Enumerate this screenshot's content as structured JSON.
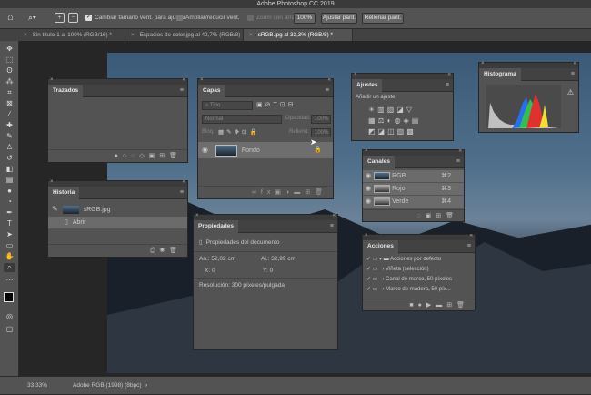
{
  "app": {
    "title": "Adobe Photoshop CC 2019"
  },
  "options": {
    "resize_windows_label": "Cambiar tamaño vent. para ajustar",
    "zoom_all_label": "Ampliar/reducir vent.",
    "scrubby_label": "Zoom con arrastre",
    "zoom_value": "100%",
    "fit_screen_label": "Ajustar pant.",
    "fill_screen_label": "Rellenar pant."
  },
  "tabs": [
    {
      "label": "Sin título-1 al 100% (RGB/16) *"
    },
    {
      "label": "Espacios de color.jpg al 42,7% (RGB/8)"
    },
    {
      "label": "sRGB.jpg al 33,3% (RGB/8) *"
    }
  ],
  "panels": {
    "trazados": {
      "title": "Trazados"
    },
    "historia": {
      "title": "Historia",
      "snapshot": "sRGB.jpg",
      "items": [
        "Abrir"
      ]
    },
    "capas": {
      "title": "Capas",
      "filter": "Tipo",
      "blend": "Normal",
      "opacity_label": "Opacidad:",
      "opacity_value": "100%",
      "lock_label": "Bloq.:",
      "fill_label": "Relleno:",
      "fill_value": "100%",
      "layer_name": "Fondo"
    },
    "propiedades": {
      "title": "Propiedades",
      "doc_label": "Propiedades del documento",
      "an_label": "An.:",
      "an_value": "52,02 cm",
      "al_label": "Al.:",
      "al_value": "32,99 cm",
      "x_label": "X:",
      "x_value": "0",
      "y_label": "Y:",
      "y_value": "0",
      "resolution": "Resolución: 300 píxeles/pulgada"
    },
    "ajustes": {
      "title": "Ajustes",
      "subtitle": "Añadir un ajuste"
    },
    "histograma": {
      "title": "Histograma"
    },
    "canales": {
      "title": "Canales",
      "channels": [
        {
          "name": "RGB",
          "shortcut": "⌘2"
        },
        {
          "name": "Rojo",
          "shortcut": "⌘3"
        },
        {
          "name": "Verde",
          "shortcut": "⌘4"
        }
      ]
    },
    "acciones": {
      "title": "Acciones",
      "items": [
        "Acciones por defecto",
        "Viñeta (selección)",
        "Canal de marco, 50 píxeles",
        "Marco de madera, 50 píx..."
      ]
    }
  },
  "status": {
    "zoom": "33,33%",
    "profile": "Adobe RGB (1998) (8bpc)"
  }
}
